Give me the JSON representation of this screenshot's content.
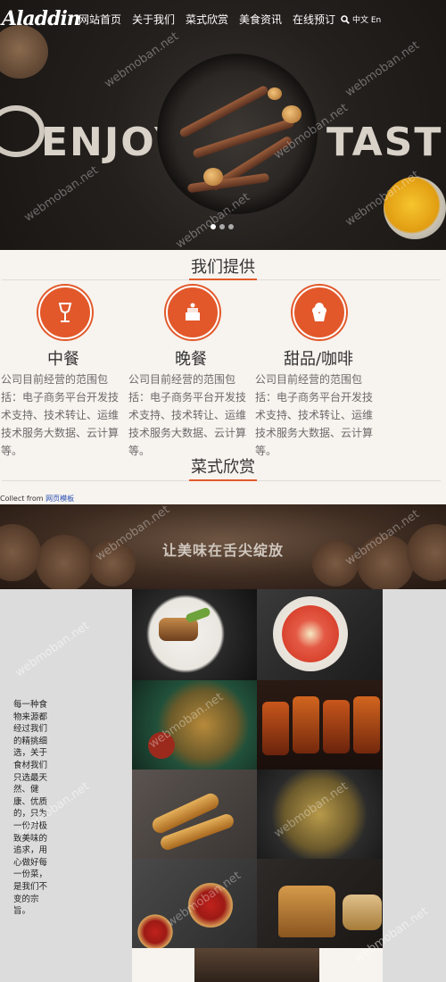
{
  "nav": {
    "logo": "Aladdin",
    "items": [
      "网站首页",
      "关于我们",
      "菜式欣赏",
      "美食资讯",
      "在线预订"
    ],
    "lang": "中文 En"
  },
  "hero": {
    "word_left": "ENJOY",
    "word_right": "TASTE",
    "slides": 3,
    "active_slide": 1,
    "watermark": "webmoban.net"
  },
  "services": {
    "title": "我们提供",
    "items": [
      {
        "name": "中餐",
        "icon": "wine-glass-icon",
        "desc": "公司目前经营的范围包括：电子商务平台开发技术支持、技术转让、运维技术服务大数据、云计算等。"
      },
      {
        "name": "晚餐",
        "icon": "cake-icon",
        "desc": "公司目前经营的范围包括：电子商务平台开发技术支持、技术转让、运维技术服务大数据、云计算等。"
      },
      {
        "name": "甜品/咖啡",
        "icon": "cupcake-icon",
        "desc": "公司目前经营的范围包括：电子商务平台开发技术支持、技术转让、运维技术服务大数据、云计算等。"
      }
    ]
  },
  "gallery": {
    "title": "菜式欣赏",
    "collect_prefix": "Collect from ",
    "collect_link": "网页模板",
    "banner": "让美味在舌尖绽放",
    "side_text": "每一种食物来源都经过我们的精挑细选，关于食材我们只选最天然、健康、优质的，只为一份对极致美味的追求，用心做好每一份菜，是我们不变的宗旨。"
  },
  "colors": {
    "accent": "#e2582a",
    "dark": "#221e1b"
  }
}
